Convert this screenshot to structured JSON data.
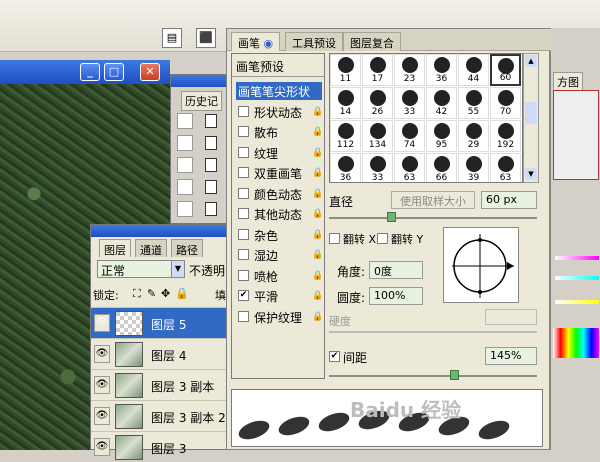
{
  "brush_panel": {
    "tabs": [
      "画笔",
      "工具预设",
      "图层复合"
    ],
    "list_header": "画笔预设",
    "list": [
      {
        "label": "画笔笔尖形状",
        "checked": null,
        "selected": true,
        "lock": false
      },
      {
        "label": "形状动态",
        "checked": false,
        "lock": true
      },
      {
        "label": "散布",
        "checked": false,
        "lock": true
      },
      {
        "label": "纹理",
        "checked": false,
        "lock": true
      },
      {
        "label": "双重画笔",
        "checked": false,
        "lock": true
      },
      {
        "label": "颜色动态",
        "checked": false,
        "lock": true
      },
      {
        "label": "其他动态",
        "checked": false,
        "lock": true
      },
      {
        "label": "杂色",
        "checked": false,
        "lock": true
      },
      {
        "label": "湿边",
        "checked": false,
        "lock": true
      },
      {
        "label": "喷枪",
        "checked": false,
        "lock": true
      },
      {
        "label": "平滑",
        "checked": true,
        "lock": true
      },
      {
        "label": "保护纹理",
        "checked": false,
        "lock": true
      }
    ],
    "brush_sizes": [
      "11",
      "17",
      "23",
      "36",
      "44",
      "60",
      "14",
      "26",
      "33",
      "42",
      "55",
      "70",
      "112",
      "134",
      "74",
      "95",
      "29",
      "192",
      "36",
      "33",
      "63",
      "66",
      "39",
      "63"
    ],
    "selected_brush_index": 5,
    "diameter_label": "直径",
    "use_sample_size_label": "使用取样大小",
    "diameter_value": "60 px",
    "flip_x_label": "翻转 X",
    "flip_y_label": "翻转 Y",
    "angle_label": "角度:",
    "angle_value": "0度",
    "roundness_label": "圆度:",
    "roundness_value": "100%",
    "hardness_label": "硬度",
    "spacing_label": "间距",
    "spacing_checked": true,
    "spacing_value": "145%",
    "diameter_slider_fraction": 0.3,
    "spacing_slider_fraction": 0.6
  },
  "history_panel": {
    "tab": "历史记"
  },
  "layers_panel": {
    "tabs": [
      "图层",
      "通道",
      "路径"
    ],
    "blend_mode": "正常",
    "opacity_label": "不透明",
    "lock_label": "锁定:",
    "fill_label": "填",
    "layers": [
      {
        "name": "图层 5",
        "selected": true,
        "thumb": "checker"
      },
      {
        "name": "图层 4",
        "selected": false,
        "thumb": "photo"
      },
      {
        "name": "图层 3 副本",
        "selected": false,
        "thumb": "photo"
      },
      {
        "name": "图层 3 副本 2",
        "selected": false,
        "thumb": "photo"
      },
      {
        "name": "图层 3",
        "selected": false,
        "thumb": "photo"
      }
    ]
  },
  "right_panel": {
    "tab": "方图"
  },
  "watermark": "Baidu 经验"
}
